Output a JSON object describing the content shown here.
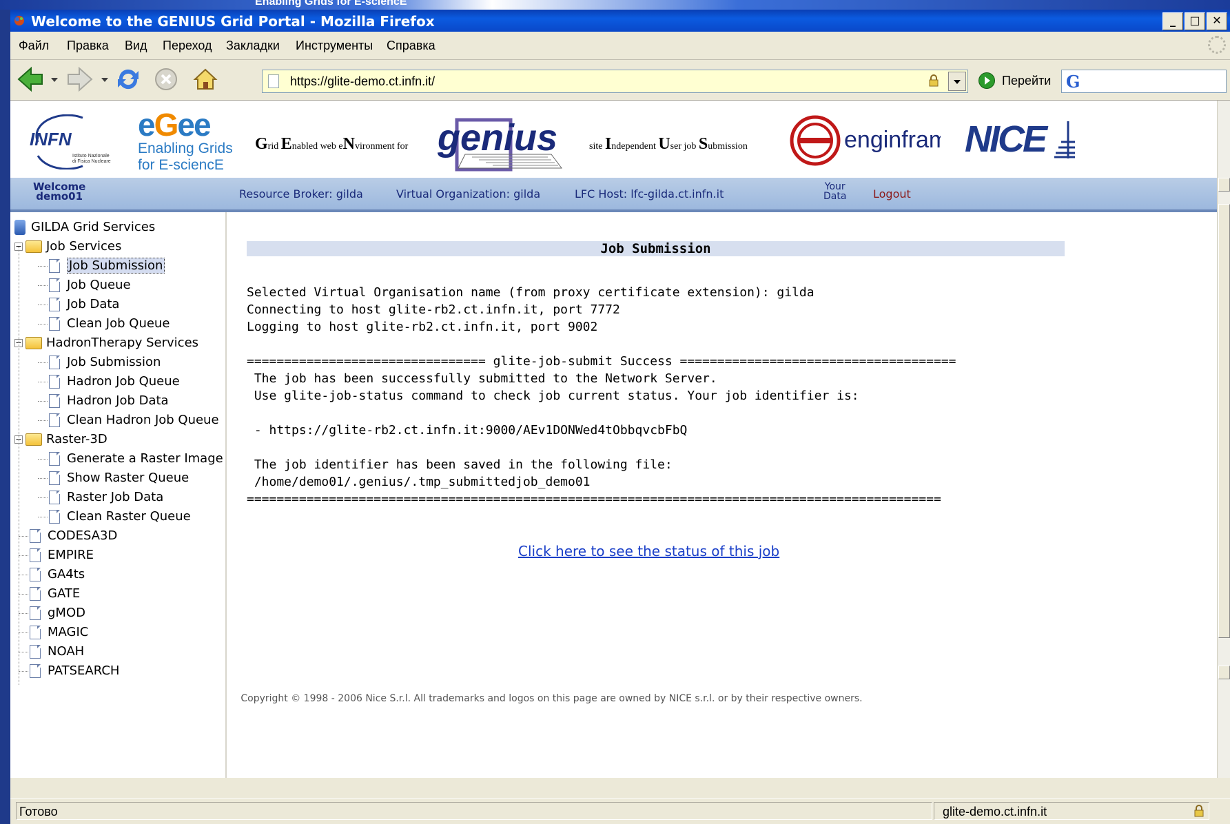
{
  "window": {
    "title": "Welcome to the GENIUS Grid Portal - Mozilla Firefox",
    "bg_strip_text": "Enabling Grids for E-sciencE"
  },
  "menu": [
    "Файл",
    "Правка",
    "Вид",
    "Переход",
    "Закладки",
    "Инструменты",
    "Справка"
  ],
  "toolbar": {
    "url": "https://glite-demo.ct.infn.it/",
    "go_label": "Перейти",
    "search_placeholder": "G"
  },
  "logos": {
    "infn": "INFN",
    "infn_sub": "Istituto Nazionale di Fisica Nucleare",
    "egee": "egee",
    "egee_line1": "Enabling Grids",
    "egee_line2": "for E-sciencE",
    "grid_enabled": "Grid Enabled web eNvironment for",
    "genius": "genius",
    "site_independent": "site Independent User job Submission",
    "enginframe": "enginframe",
    "nice": "NICE"
  },
  "bluebar": {
    "welcome_1": "Welcome",
    "welcome_2": "demo01",
    "resource_broker": "Resource Broker: gilda",
    "virtual_org": "Virtual Organization: gilda",
    "lfc_host": "LFC Host: lfc-gilda.ct.infn.it",
    "your_1": "Your",
    "your_2": "Data",
    "logout": "Logout"
  },
  "sidebar": {
    "root": "GILDA Grid Services",
    "items": [
      {
        "label": "Job Services",
        "type": "folder",
        "level": 0
      },
      {
        "label": "Job Submission",
        "type": "doc",
        "level": 1,
        "selected": true
      },
      {
        "label": "Job Queue",
        "type": "doc",
        "level": 1
      },
      {
        "label": "Job Data",
        "type": "doc",
        "level": 1
      },
      {
        "label": "Clean Job Queue",
        "type": "doc",
        "level": 1
      },
      {
        "label": "HadronTherapy Services",
        "type": "folder",
        "level": 0
      },
      {
        "label": "Job Submission",
        "type": "doc",
        "level": 1
      },
      {
        "label": "Hadron Job Queue",
        "type": "doc",
        "level": 1
      },
      {
        "label": "Hadron Job Data",
        "type": "doc",
        "level": 1
      },
      {
        "label": "Clean Hadron Job Queue",
        "type": "doc",
        "level": 1
      },
      {
        "label": "Raster-3D",
        "type": "folder",
        "level": 0
      },
      {
        "label": "Generate a Raster Image",
        "type": "doc",
        "level": 1
      },
      {
        "label": "Show Raster Queue",
        "type": "doc",
        "level": 1
      },
      {
        "label": "Raster Job Data",
        "type": "doc",
        "level": 1
      },
      {
        "label": "Clean Raster Queue",
        "type": "doc",
        "level": 1
      },
      {
        "label": "CODESA3D",
        "type": "doc",
        "level": 0
      },
      {
        "label": "EMPIRE",
        "type": "doc",
        "level": 0
      },
      {
        "label": "GA4ts",
        "type": "doc",
        "level": 0
      },
      {
        "label": "GATE",
        "type": "doc",
        "level": 0
      },
      {
        "label": "gMOD",
        "type": "doc",
        "level": 0
      },
      {
        "label": "MAGIC",
        "type": "doc",
        "level": 0
      },
      {
        "label": "NOAH",
        "type": "doc",
        "level": 0
      },
      {
        "label": "PATSEARCH",
        "type": "doc",
        "level": 0
      }
    ]
  },
  "main": {
    "title": "Job Submission",
    "lines": [
      "Selected Virtual Organisation name (from proxy certificate extension): gilda",
      "Connecting to host glite-rb2.ct.infn.it, port 7772",
      "Logging to host glite-rb2.ct.infn.it, port 9002",
      "",
      "================================ glite-job-submit Success =====================================",
      " The job has been successfully submitted to the Network Server.",
      " Use glite-job-status command to check job current status. Your job identifier is:",
      "",
      " - https://glite-rb2.ct.infn.it:9000/AEv1DONWed4tObbqvcbFbQ",
      "",
      " The job identifier has been saved in the following file:",
      " /home/demo01/.genius/.tmp_submittedjob_demo01",
      "============================================================================================="
    ],
    "status_link": "Click here to see the status of this job"
  },
  "footer": {
    "copyright": "Copyright © 1998 - 2006 Nice S.r.l. All trademarks and logos on this page are owned by NICE s.r.l. or by their respective owners."
  },
  "statusbar": {
    "left": "Готово",
    "right": "glite-demo.ct.infn.it"
  }
}
